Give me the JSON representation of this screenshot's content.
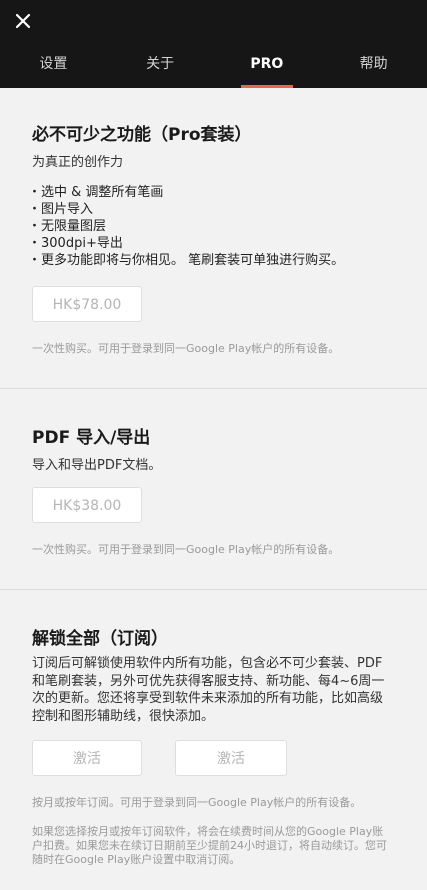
{
  "tabs": [
    {
      "label": "设置"
    },
    {
      "label": "关于"
    },
    {
      "label": "PRO"
    },
    {
      "label": "帮助"
    }
  ],
  "accent_color": "#e8684a",
  "sections": {
    "essentials": {
      "title": "必不可少之功能（Pro套装）",
      "subtitle": "为真正的创作力",
      "features": [
        "选中 & 调整所有笔画",
        "图片导入",
        "无限量图层",
        "300dpi+导出",
        "更多功能即将与你相见。 笔刷套装可单独进行购买。"
      ],
      "price": "HK$78.00",
      "note": "一次性购买。可用于登录到同一Google Play帐户的所有设备。"
    },
    "pdf": {
      "title": "PDF 导入/导出",
      "subtitle": "导入和导出PDF文档。",
      "price": "HK$38.00",
      "note": "一次性购买。可用于登录到同一Google Play帐户的所有设备。"
    },
    "unlock_all": {
      "title": "解锁全部（订阅）",
      "description": "订阅后可解锁使用软件内所有功能，包含必不可少套装、PDF和笔刷套装，另外可优先获得客服支持、新功能、每4~6周一次的更新。您还将享受到软件未来添加的所有功能，比如高级控制和图形辅助线，很快添加。",
      "activate_monthly": "激活",
      "activate_yearly": "激活",
      "note": "按月或按年订阅。可用于登录到同一Google Play帐户的所有设备。",
      "fine_print": "如果您选择按月或按年订阅软件，将会在续费时间从您的Google Play账户扣费。如果您未在续订日期前至少提前24小时退订，将自动续订。您可随时在Google Play账户设置中取消订阅。"
    }
  }
}
